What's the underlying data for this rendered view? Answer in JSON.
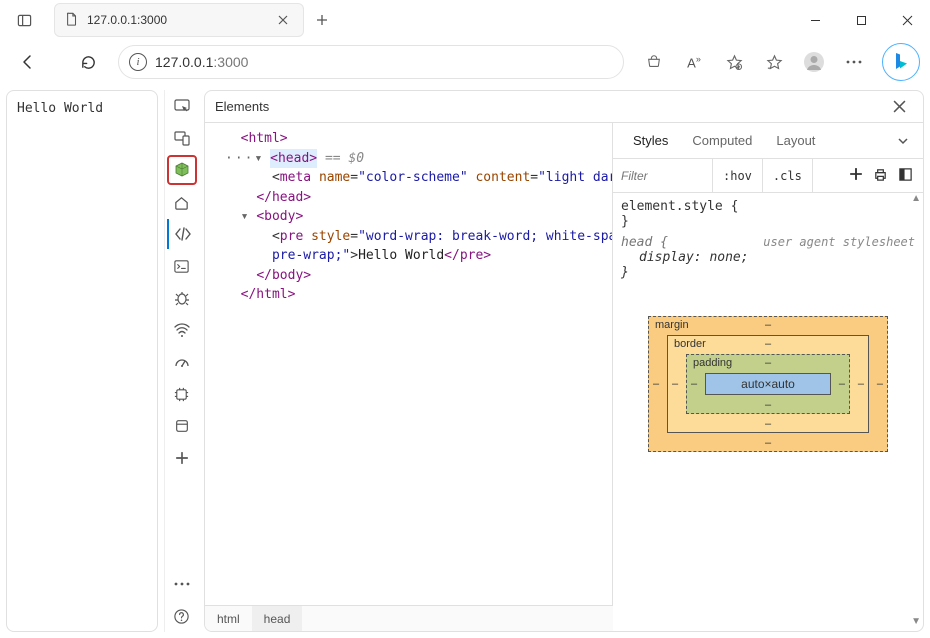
{
  "browser": {
    "tab_title": "127.0.0.1:3000",
    "url_host": "127.0.0.1",
    "url_port": ":3000"
  },
  "page": {
    "body_text": "Hello World"
  },
  "devtools": {
    "header": "Elements",
    "dom": {
      "html_open": "<html>",
      "head_open": "<head>",
      "eq0": "== $0",
      "meta_tag": "meta",
      "meta_attr_name": "name",
      "meta_val_name": "\"color-scheme\"",
      "meta_attr_content": "content",
      "meta_val_content": "\"light dark\"",
      "head_close": "</head>",
      "body_open": "<body>",
      "pre_open_tag": "pre",
      "pre_style_attr": "style",
      "pre_style_val": "\"word-wrap: break-word; white-space:",
      "pre_style_val2": "pre-wrap;\"",
      "pre_text": "Hello World",
      "pre_close": "</pre>",
      "body_close": "</body>",
      "html_close": "</html>"
    },
    "breadcrumbs": [
      "html",
      "head"
    ]
  },
  "styles": {
    "tabs": [
      "Styles",
      "Computed",
      "Layout"
    ],
    "filter_placeholder": "Filter",
    "hov": ":hov",
    "cls": ".cls",
    "rule1_selector": "element.style {",
    "rule1_close": "}",
    "rule2_selector": "head {",
    "rule2_origin": "user agent stylesheet",
    "rule2_prop_name": "display",
    "rule2_prop_val": "none",
    "rule2_close": "}"
  },
  "box_model": {
    "margin_label": "margin",
    "border_label": "border",
    "padding_label": "padding",
    "content": "auto×auto",
    "dash": "–"
  }
}
